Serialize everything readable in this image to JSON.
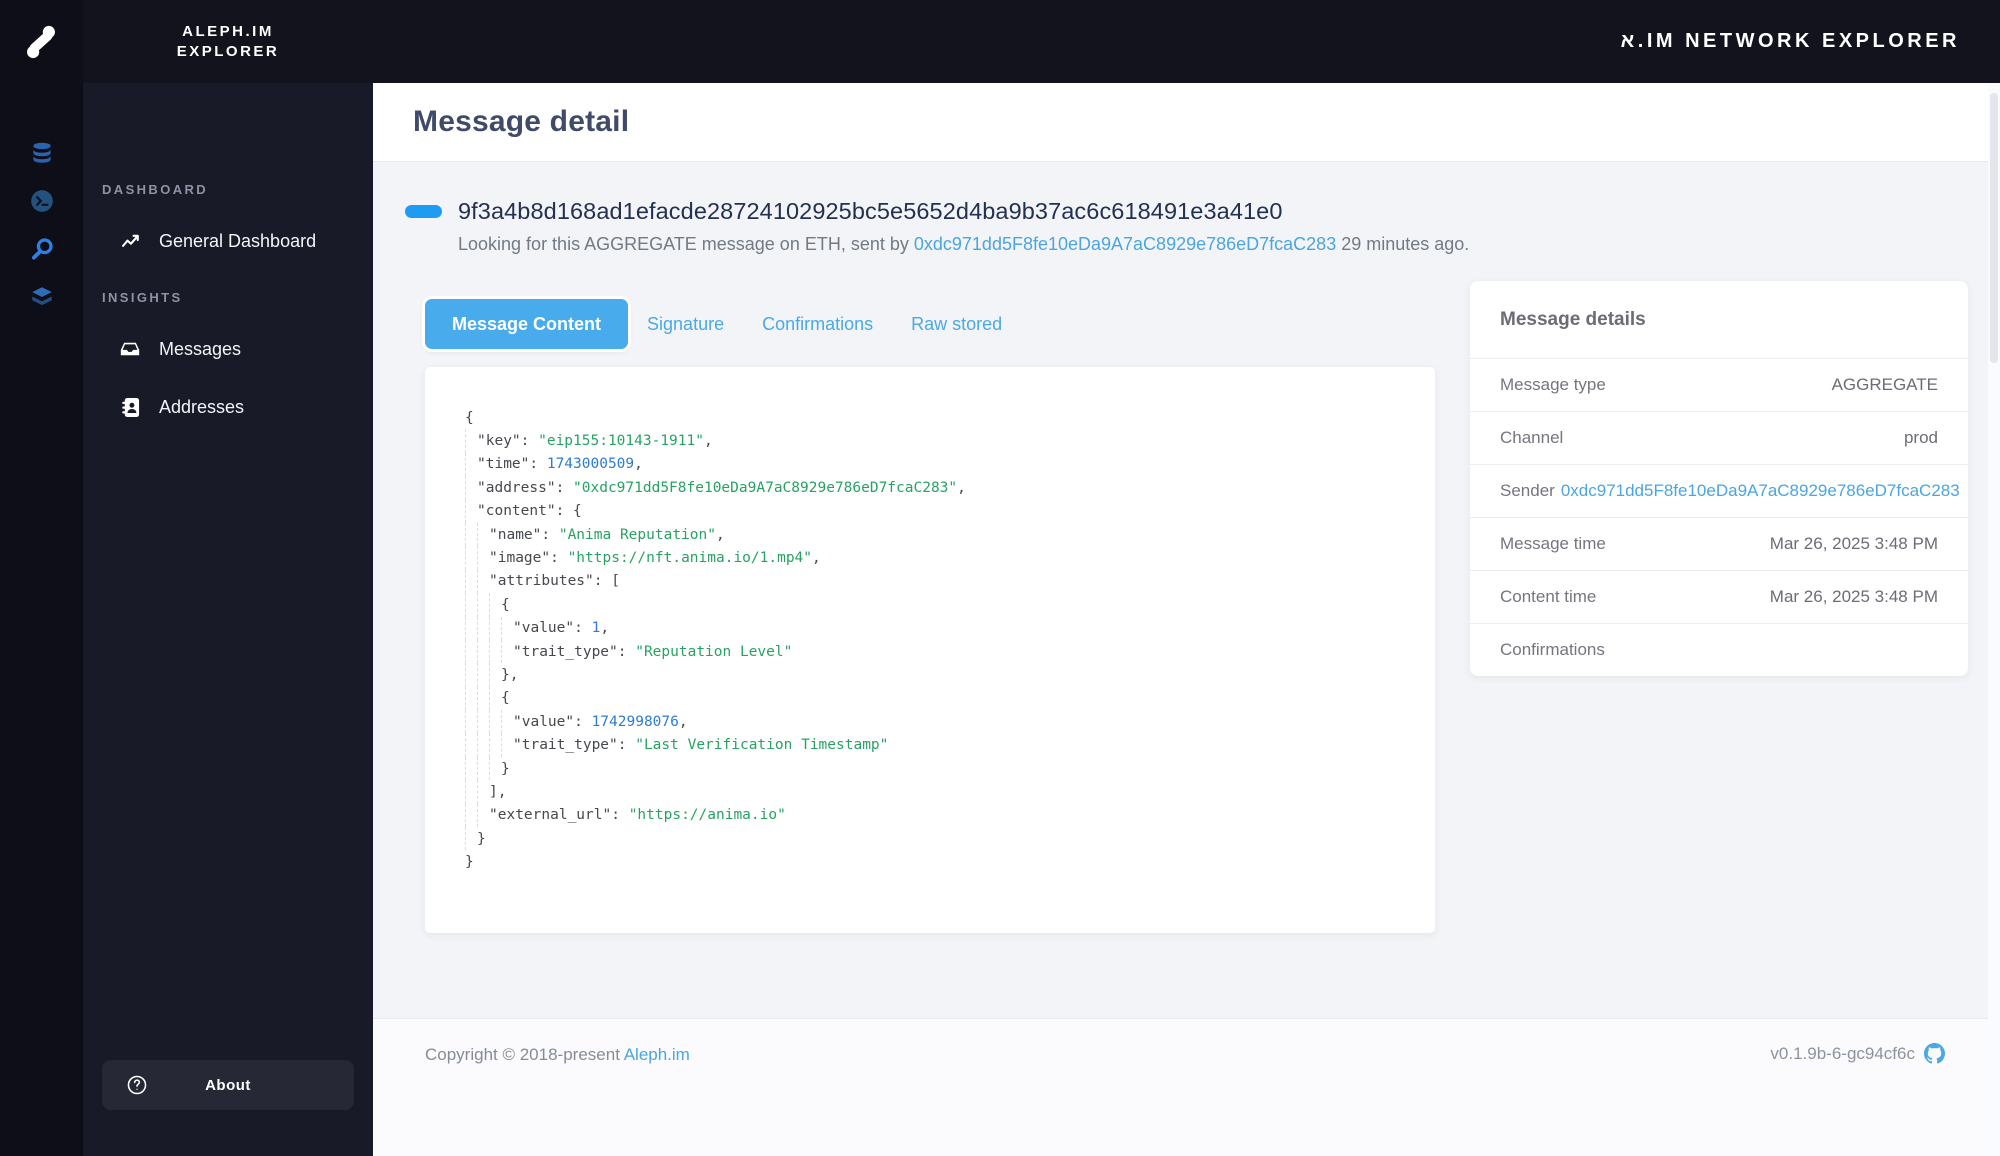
{
  "brand": {
    "line1": "ALEPH.IM",
    "line2": "EXPLORER"
  },
  "topbar": {
    "title": "א.IM NETWORK EXPLORER"
  },
  "sidebar": {
    "sections": [
      {
        "label": "DASHBOARD",
        "items": [
          {
            "label": "General Dashboard",
            "icon": "chart-line-icon"
          }
        ]
      },
      {
        "label": "INSIGHTS",
        "items": [
          {
            "label": "Messages",
            "icon": "inbox-icon"
          },
          {
            "label": "Addresses",
            "icon": "address-book-icon"
          }
        ]
      }
    ],
    "about_label": "About"
  },
  "rail": {
    "icons": [
      "database-icon",
      "terminal-icon",
      "search-icon",
      "layers-icon"
    ]
  },
  "page": {
    "title": "Message detail"
  },
  "message": {
    "hash": "9f3a4b8d168ad1efacde28724102925bc5e5652d4ba9b37ac6c618491e3a41e0",
    "subtitle_prefix": "Looking for this AGGREGATE message on ETH, sent by ",
    "sender": "0xdc971dd5F8fe10eDa9A7aC8929e786eD7fcaC283",
    "subtitle_suffix": " 29 minutes ago."
  },
  "tabs": [
    {
      "label": "Message Content",
      "active": true
    },
    {
      "label": "Signature",
      "active": false
    },
    {
      "label": "Confirmations",
      "active": false
    },
    {
      "label": "Raw stored",
      "active": false
    }
  ],
  "code": {
    "lines": [
      [
        0,
        [
          [
            "p",
            "{"
          ]
        ]
      ],
      [
        1,
        [
          [
            "p",
            "\"key\": "
          ],
          [
            "s",
            "\"eip155:10143-1911\""
          ],
          [
            "p",
            ","
          ]
        ]
      ],
      [
        1,
        [
          [
            "p",
            "\"time\": "
          ],
          [
            "n",
            "1743000509"
          ],
          [
            "p",
            ","
          ]
        ]
      ],
      [
        1,
        [
          [
            "p",
            "\"address\": "
          ],
          [
            "s",
            "\"0xdc971dd5F8fe10eDa9A7aC8929e786eD7fcaC283\""
          ],
          [
            "p",
            ","
          ]
        ]
      ],
      [
        1,
        [
          [
            "p",
            "\"content\": {"
          ]
        ]
      ],
      [
        2,
        [
          [
            "p",
            "\"name\": "
          ],
          [
            "s",
            "\"Anima Reputation\""
          ],
          [
            "p",
            ","
          ]
        ]
      ],
      [
        2,
        [
          [
            "p",
            "\"image\": "
          ],
          [
            "s",
            "\"https://nft.anima.io/1.mp4\""
          ],
          [
            "p",
            ","
          ]
        ]
      ],
      [
        2,
        [
          [
            "p",
            "\"attributes\": ["
          ]
        ]
      ],
      [
        3,
        [
          [
            "p",
            "{"
          ]
        ]
      ],
      [
        4,
        [
          [
            "p",
            "\"value\": "
          ],
          [
            "n",
            "1"
          ],
          [
            "p",
            ","
          ]
        ]
      ],
      [
        4,
        [
          [
            "p",
            "\"trait_type\": "
          ],
          [
            "s",
            "\"Reputation Level\""
          ]
        ]
      ],
      [
        3,
        [
          [
            "p",
            "},"
          ]
        ]
      ],
      [
        3,
        [
          [
            "p",
            "{"
          ]
        ]
      ],
      [
        4,
        [
          [
            "p",
            "\"value\": "
          ],
          [
            "n",
            "1742998076"
          ],
          [
            "p",
            ","
          ]
        ]
      ],
      [
        4,
        [
          [
            "p",
            "\"trait_type\": "
          ],
          [
            "s",
            "\"Last Verification Timestamp\""
          ]
        ]
      ],
      [
        3,
        [
          [
            "p",
            "}"
          ]
        ]
      ],
      [
        2,
        [
          [
            "p",
            "],"
          ]
        ]
      ],
      [
        2,
        [
          [
            "p",
            "\"external_url\": "
          ],
          [
            "s",
            "\"https://anima.io\""
          ]
        ]
      ],
      [
        1,
        [
          [
            "p",
            "}"
          ]
        ]
      ],
      [
        0,
        [
          [
            "p",
            "}"
          ]
        ]
      ]
    ]
  },
  "details": {
    "title": "Message details",
    "rows": [
      {
        "label": "Message type",
        "value": "AGGREGATE"
      },
      {
        "label": "Channel",
        "value": "prod"
      },
      {
        "label": "Sender",
        "link": "0xdc971dd5F8fe10eDa9A7aC8929e786eD7fcaC283"
      },
      {
        "label": "Message time",
        "value": "Mar 26, 2025 3:48 PM"
      },
      {
        "label": "Content time",
        "value": "Mar 26, 2025 3:48 PM"
      },
      {
        "label": "Confirmations",
        "value": ""
      }
    ]
  },
  "footer": {
    "copyright_prefix": "Copyright © 2018-present ",
    "copyright_link": "Aleph.im",
    "version": "v0.1.9b-6-gc94cf6c"
  },
  "colors": {
    "accent_blue": "#47abec",
    "link_blue": "#4aa5e2",
    "pill_blue": "#1e9cf3",
    "code_green": "#28a263",
    "code_number_blue": "#2e7bd4",
    "topbar_bg": "#12131d",
    "rail_bg": "#0d0e17",
    "sidebar_bg": "#191a28"
  }
}
